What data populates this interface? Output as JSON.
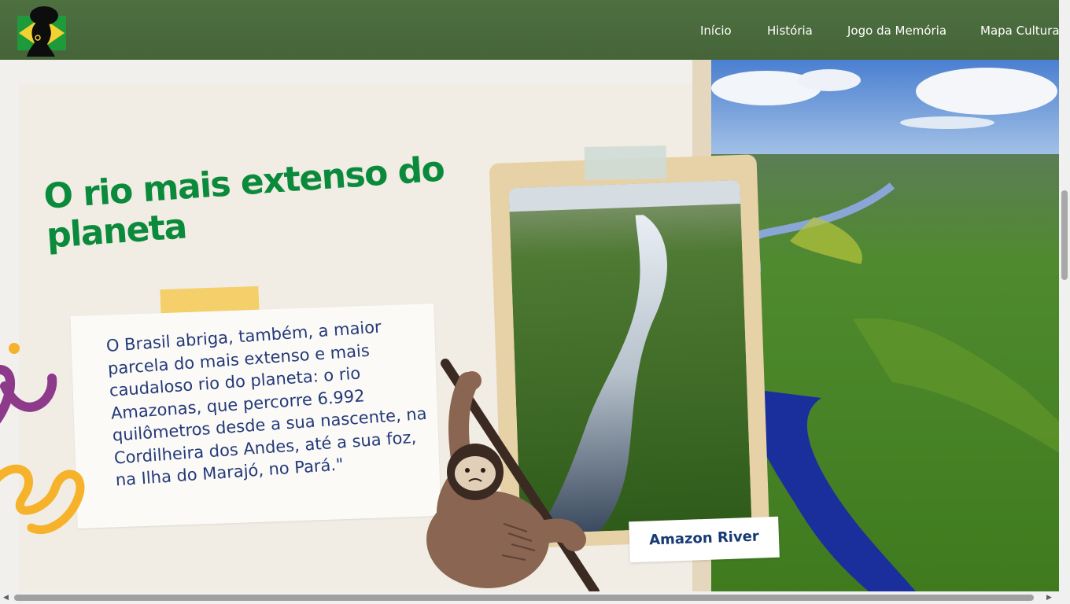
{
  "header": {
    "logo_icon": "afro-brazil-flag-logo-icon",
    "nav": [
      {
        "label": "Início"
      },
      {
        "label": "História"
      },
      {
        "label": "Jogo da Memória"
      },
      {
        "label": "Mapa Cultural"
      }
    ]
  },
  "main": {
    "title": "O rio mais extenso do planeta",
    "body": "O Brasil abriga, também, a maior parcela do mais extenso e mais caudaloso rio do planeta: o rio Amazonas, que percorre 6.992 quilômetros desde a sua nascente, na Cordilheira dos Andes, até a sua foz, na Ilha do Marajó, no Pará.\"",
    "photo_caption": "Amazon River",
    "illustration_icon": "sloth-icon"
  },
  "colors": {
    "header_bg": "#4a6b3d",
    "title_green": "#0b8a3c",
    "text_blue": "#243a7a",
    "caption_blue": "#163a74",
    "tape_yellow": "#f4cf6a"
  }
}
